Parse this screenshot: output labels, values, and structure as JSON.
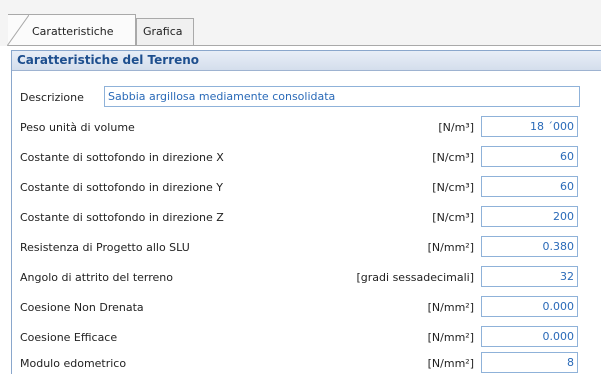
{
  "tabs": [
    {
      "label": "Caratteristiche",
      "active": true
    },
    {
      "label": "Grafica",
      "active": false
    }
  ],
  "panel": {
    "title": "Caratteristiche del Terreno",
    "description": {
      "label": "Descrizione",
      "value": "Sabbia argillosa mediamente consolidata"
    },
    "rows": [
      {
        "label": "Peso unità di volume",
        "unit": "[N/m³]",
        "value": "18 ´000"
      },
      {
        "label": "Costante di sottofondo in direzione X",
        "unit": "[N/cm³]",
        "value": "60"
      },
      {
        "label": "Costante di sottofondo in direzione Y",
        "unit": "[N/cm³]",
        "value": "60"
      },
      {
        "label": "Costante di sottofondo in direzione Z",
        "unit": "[N/cm³]",
        "value": "200"
      },
      {
        "label": "Resistenza di Progetto allo SLU",
        "unit": "[N/mm²]",
        "value": "0.380"
      },
      {
        "label": "Angolo di attrito del terreno",
        "unit": "[gradi sessadecimali]",
        "value": "32"
      },
      {
        "label": "Coesione Non Drenata",
        "unit": "[N/mm²]",
        "value": "0.000"
      },
      {
        "label": "Coesione Efficace",
        "unit": "[N/mm²]",
        "value": "0.000"
      },
      {
        "label": "Modulo edometrico",
        "unit": "[N/mm²]",
        "value": "8"
      }
    ]
  },
  "colors": {
    "accent": "#1e4f8e",
    "value_text": "#2a6ab8",
    "field_border": "#8fb2d9"
  }
}
